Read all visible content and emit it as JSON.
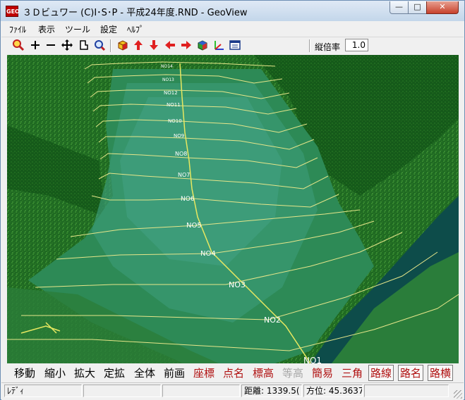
{
  "window": {
    "title": "３Ｄビュワー (C)I･S･P - 平成24年度.RND - GeoView",
    "icon_text": "GEO",
    "controls": {
      "minimize": "—",
      "maximize": "□",
      "close": "✕"
    }
  },
  "menu": [
    "ﾌｧｲﾙ",
    "表示",
    "ツール",
    "設定",
    "ﾍﾙﾌﾟ"
  ],
  "toolbar": {
    "icons": [
      "zoom-icon",
      "plus-icon",
      "minus-icon",
      "move-icon",
      "rotate-icon",
      "zoom-area-icon",
      "cube-icon",
      "arrow-up-icon",
      "arrow-down-icon",
      "arrow-left-icon",
      "arrow-right-icon",
      "box-color-icon",
      "axis-icon",
      "window-icon"
    ],
    "vertical_scale_label": "縦倍率",
    "vertical_scale_value": "1.0"
  },
  "colors": {
    "background": "#0d4c4a",
    "terrain": "#1d6d25",
    "channel": "#2f8f68",
    "survey_line": "#e6e68a",
    "route_line": "#e8e860",
    "label": "#ffffff"
  },
  "stations": [
    "NO14",
    "NO13",
    "NO12",
    "NO11",
    "NO10",
    "NO9",
    "NO8",
    "NO7",
    "NO6",
    "NO5",
    "NO4",
    "NO3",
    "NO2",
    "NO1"
  ],
  "command_buttons": [
    {
      "label": "移動",
      "state": "normal"
    },
    {
      "label": "縮小",
      "state": "normal"
    },
    {
      "label": "拡大",
      "state": "normal"
    },
    {
      "label": "定拡",
      "state": "normal"
    },
    {
      "label": "全体",
      "state": "normal"
    },
    {
      "label": "前画",
      "state": "normal"
    },
    {
      "label": "座標",
      "state": "red"
    },
    {
      "label": "点名",
      "state": "red"
    },
    {
      "label": "標高",
      "state": "red"
    },
    {
      "label": "等高",
      "state": "disabled"
    },
    {
      "label": "簡易",
      "state": "red"
    },
    {
      "label": "三角",
      "state": "red"
    },
    {
      "label": "路線",
      "state": "red-pressed"
    },
    {
      "label": "路名",
      "state": "red-pressed"
    },
    {
      "label": "路横",
      "state": "red-pressed"
    }
  ],
  "status": {
    "ready": "ﾚﾃﾞｨ",
    "distance_label": "距離:",
    "distance_value": "1339.5(",
    "bearing_label": "方位:",
    "bearing_value": "45.3637"
  }
}
